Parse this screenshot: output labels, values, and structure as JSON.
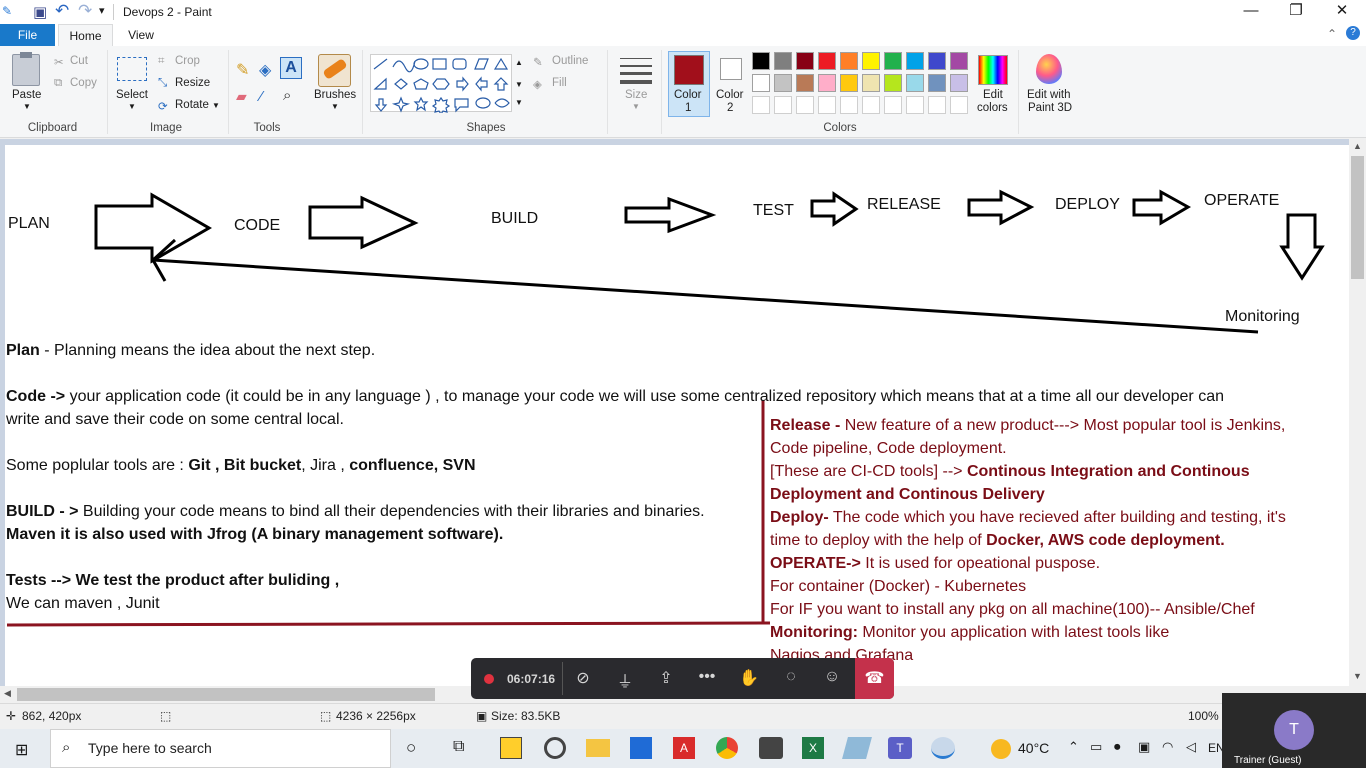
{
  "window": {
    "title": "Devops 2 - Paint",
    "minimize": "—",
    "maximize": "❐",
    "close": "✕"
  },
  "qat": {
    "app": "✎",
    "save": "▣",
    "undo": "↶",
    "redo": "↷",
    "more": "▾"
  },
  "tabs": {
    "file": "File",
    "home": "Home",
    "view": "View"
  },
  "ribbon": {
    "clipboard": {
      "paste": "Paste",
      "cut": "Cut",
      "copy": "Copy",
      "group": "Clipboard"
    },
    "image": {
      "select": "Select",
      "crop": "Crop",
      "resize": "Resize",
      "rotate": "Rotate",
      "group": "Image"
    },
    "tools": {
      "group": "Tools"
    },
    "brushes": {
      "label": "Brushes"
    },
    "shapes": {
      "outline": "Outline",
      "fill": "Fill",
      "group": "Shapes"
    },
    "size": {
      "label": "Size"
    },
    "colors": {
      "color1_a": "Color",
      "color1_b": "1",
      "color2_a": "Color",
      "color2_b": "2",
      "edit_a": "Edit",
      "edit_b": "colors",
      "group": "Colors",
      "paint3d_a": "Edit with",
      "paint3d_b": "Paint 3D",
      "color1": "#a10f1b",
      "color2": "#ffffff",
      "row1": [
        "#000000",
        "#7f7f7f",
        "#880015",
        "#ed1c24",
        "#ff7f27",
        "#fff200",
        "#22b14c",
        "#00a2e8",
        "#3f48cc",
        "#a349a4"
      ],
      "row2": [
        "#ffffff",
        "#c3c3c3",
        "#b97a57",
        "#ffaec9",
        "#ffc90e",
        "#efe4b0",
        "#b5e61d",
        "#99d9ea",
        "#7092be",
        "#c8bfe7"
      ]
    }
  },
  "diagram": {
    "plan": "PLAN",
    "code": "CODE",
    "build": "BUILD",
    "test": "TEST",
    "release": "RELEASE",
    "deploy": "DEPLOY",
    "operate": "OPERATE",
    "monitoring": "Monitoring"
  },
  "notes": {
    "plan_b": "Plan",
    "plan_t": " - Planning means the idea about the next step.",
    "code_b": "Code ->",
    "code_t": " your application code (it could be in any language ) , to manage your code we will use some centralized repository which means that at a time all our developer can",
    "code2": "write and save their code on some central local.",
    "tools_t": "Some poplular tools are : ",
    "tools_b1": "Git , Bit bucket",
    ", ": "",
    "tools_t2": ", Jira , ",
    "tools_b2": "confluence, SVN",
    "build_b": "BUILD - >",
    "build_t": " Building your code means to bind all their dependencies with their libraries and binaries.",
    "maven_b": "Maven  it is also used with Jfrog (A binary management software).",
    "tests_b": "Tests --> We test the product after buliding ,",
    "tests2": "We can maven , Junit"
  },
  "right": {
    "release_b": "Release - ",
    "release_t": " New feature of a new product---> Most popular tool is Jenkins,",
    "release2": "Code pipeline, Code deployment.",
    "cicd_t": "[These are CI-CD tools] --> ",
    "cicd_b": "Continous Integration and Continous",
    "cicd2_b": "Deployment and Continous Delivery",
    "deploy_b": "Deploy-",
    "deploy_t": " The code which you have recieved after building and testing, it's",
    "deploy2_t": "time to deploy with the help of ",
    "deploy2_b": "Docker, AWS code deployment.",
    "operate_b": "OPERATE->",
    "operate_t": " It is used for opeational puspose.",
    "container": "For container (Docker) - Kubernetes",
    "install": "For IF you want to install any pkg on all machine(100)-- Ansible/Chef",
    "monitoring_b": "Monitoring:",
    "monitoring_t": "  Monitor you application with latest tools like",
    "nagios": "Nagios and Grafana"
  },
  "meeting": {
    "time": "06:07:16"
  },
  "status": {
    "cursor": "862, 420px",
    "dimensions": "4236 × 2256px",
    "size": "Size: 83.5KB",
    "zoom": "100%"
  },
  "taskbar": {
    "search": "Type here to search",
    "weather": "40°C",
    "trainer": "Trainer (Guest)",
    "avatar": "T",
    "lang": "EN"
  }
}
